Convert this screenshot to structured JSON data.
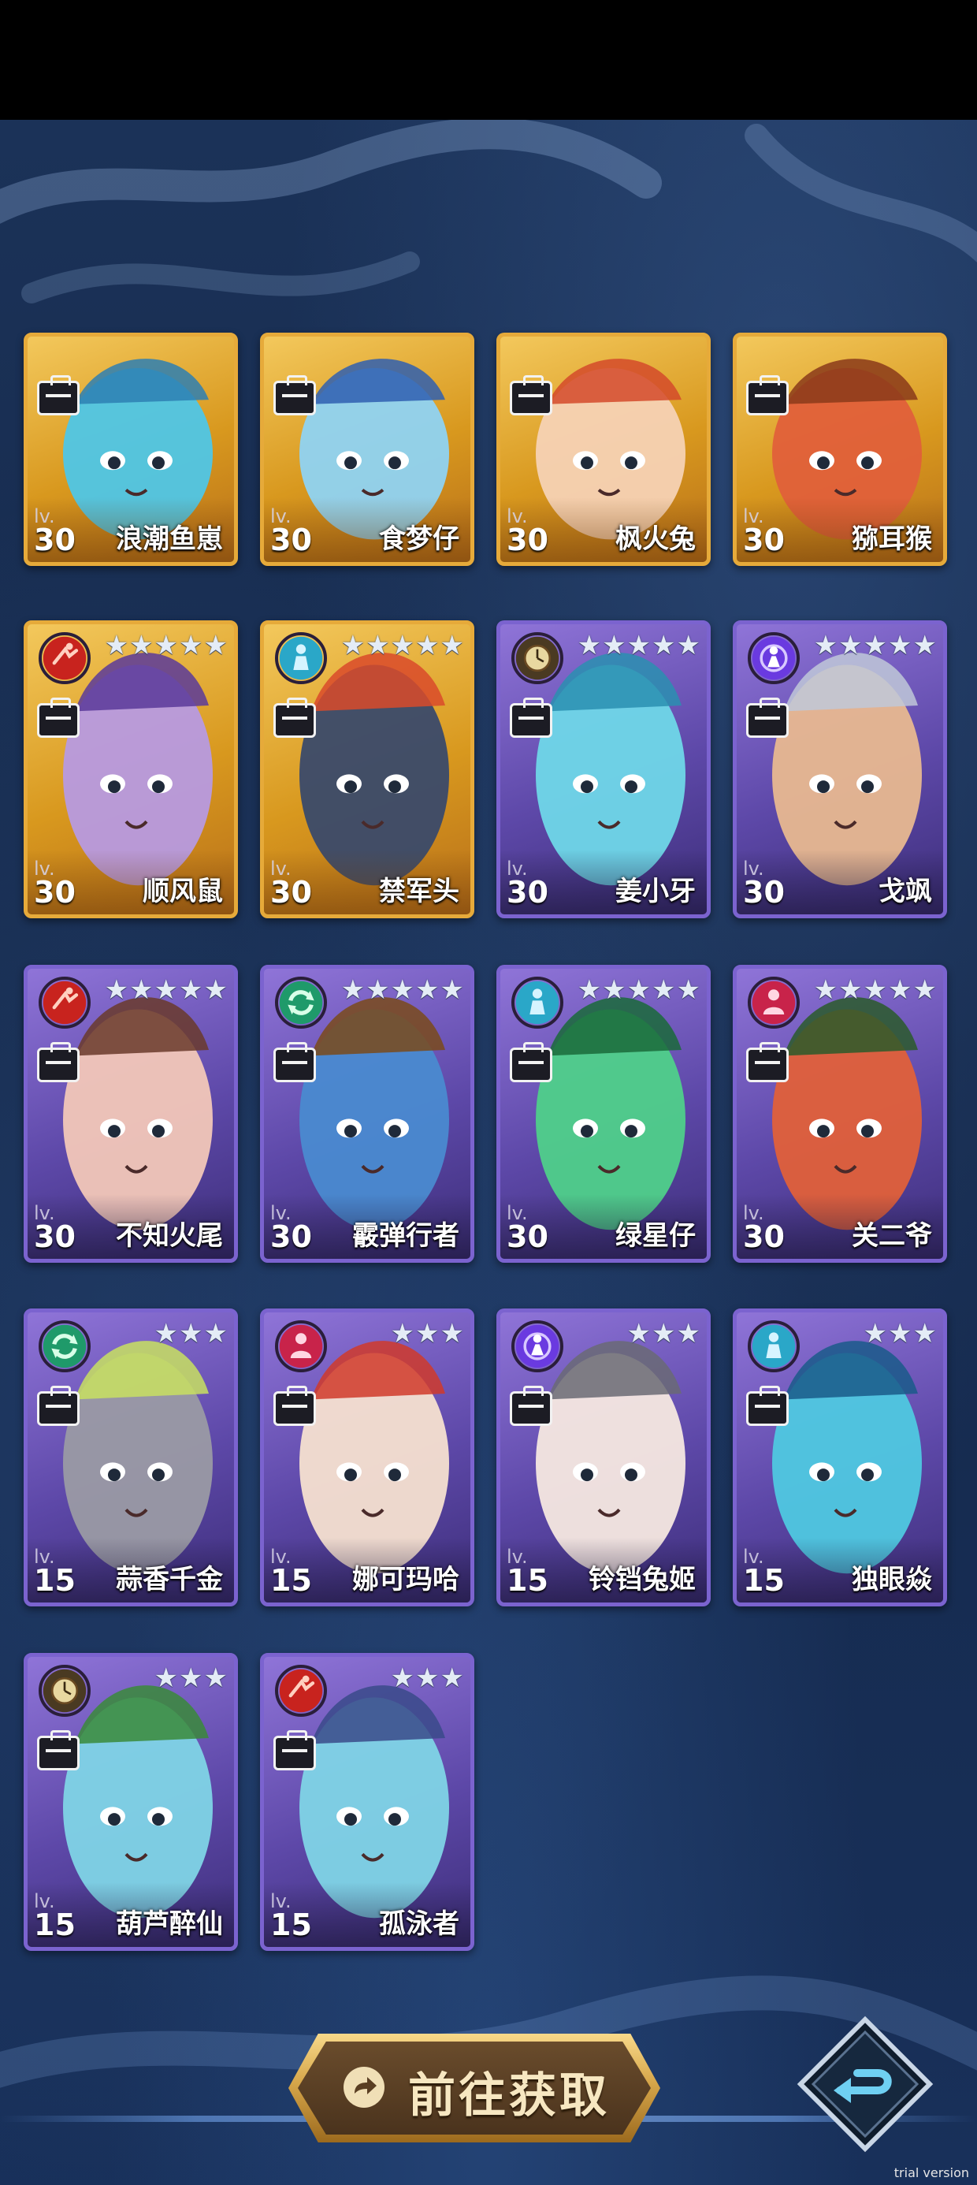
{
  "cards": [
    {
      "level": "30",
      "lv_tag": "lv.",
      "name": "浪潮鱼崽",
      "frame": "gold",
      "stars": 0,
      "badge": "",
      "clipped": true,
      "portrait": "#4fc6e6",
      "accent": "#2d7fb3"
    },
    {
      "level": "30",
      "lv_tag": "lv.",
      "name": "食梦仔",
      "frame": "gold",
      "stars": 0,
      "badge": "",
      "clipped": true,
      "portrait": "#8fd3f2",
      "accent": "#2f5fb0"
    },
    {
      "level": "30",
      "lv_tag": "lv.",
      "name": "枫火兔",
      "frame": "gold",
      "stars": 0,
      "badge": "",
      "clipped": true,
      "portrait": "#f6d2b4",
      "accent": "#d44a2a"
    },
    {
      "level": "30",
      "lv_tag": "lv.",
      "name": "猕耳猴",
      "frame": "gold",
      "stars": 0,
      "badge": "",
      "clipped": true,
      "portrait": "#e0603a",
      "accent": "#8a3a1a"
    },
    {
      "level": "30",
      "lv_tag": "lv.",
      "name": "顺风鼠",
      "frame": "gold",
      "stars": 5,
      "badge": "speed",
      "clipped": false,
      "portrait": "#b79ae0",
      "accent": "#5a3a9a"
    },
    {
      "level": "30",
      "lv_tag": "lv.",
      "name": "禁军头",
      "frame": "gold",
      "stars": 5,
      "badge": "defense",
      "clipped": false,
      "portrait": "#3a4a6a",
      "accent": "#d94a2a"
    },
    {
      "level": "30",
      "lv_tag": "lv.",
      "name": "姜小牙",
      "frame": "purple",
      "stars": 5,
      "badge": "time",
      "clipped": false,
      "portrait": "#6fd7e8",
      "accent": "#2a8fb0"
    },
    {
      "level": "30",
      "lv_tag": "lv.",
      "name": "戈飒",
      "frame": "purple",
      "stars": 5,
      "badge": "mystic",
      "clipped": false,
      "portrait": "#e8b890",
      "accent": "#c0c8d8"
    },
    {
      "level": "30",
      "lv_tag": "lv.",
      "name": "不知火尾",
      "frame": "purple",
      "stars": 5,
      "badge": "speed",
      "clipped": false,
      "portrait": "#f2c7b8",
      "accent": "#6a3a2a"
    },
    {
      "level": "30",
      "lv_tag": "lv.",
      "name": "霰弹行者",
      "frame": "purple",
      "stars": 5,
      "badge": "cycle",
      "clipped": false,
      "portrait": "#4a8ad0",
      "accent": "#7a4a1a"
    },
    {
      "level": "30",
      "lv_tag": "lv.",
      "name": "绿星仔",
      "frame": "purple",
      "stars": 5,
      "badge": "defense",
      "clipped": false,
      "portrait": "#4fd08a",
      "accent": "#1a6a3a"
    },
    {
      "level": "30",
      "lv_tag": "lv.",
      "name": "关二爷",
      "frame": "purple",
      "stars": 5,
      "badge": "team",
      "clipped": false,
      "portrait": "#e0603a",
      "accent": "#2a5a2a"
    },
    {
      "level": "15",
      "lv_tag": "lv.",
      "name": "蒜香千金",
      "frame": "purple",
      "stars": 3,
      "badge": "cycle",
      "clipped": false,
      "portrait": "#9a9aa4",
      "accent": "#c8e060"
    },
    {
      "level": "15",
      "lv_tag": "lv.",
      "name": "娜可玛哈",
      "frame": "purple",
      "stars": 3,
      "badge": "team",
      "clipped": false,
      "portrait": "#f6e0d0",
      "accent": "#d03a2a"
    },
    {
      "level": "15",
      "lv_tag": "lv.",
      "name": "铃铛兔姬",
      "frame": "purple",
      "stars": 3,
      "badge": "mystic",
      "clipped": false,
      "portrait": "#f6e8e0",
      "accent": "#6a6a74"
    },
    {
      "level": "15",
      "lv_tag": "lv.",
      "name": "独眼焱",
      "frame": "purple",
      "stars": 3,
      "badge": "defense",
      "clipped": false,
      "portrait": "#4fc8e0",
      "accent": "#1a5a8a"
    },
    {
      "level": "15",
      "lv_tag": "lv.",
      "name": "葫芦醉仙",
      "frame": "purple",
      "stars": 3,
      "badge": "time",
      "clipped": false,
      "portrait": "#7fd4e6",
      "accent": "#3a8a3a"
    },
    {
      "level": "15",
      "lv_tag": "lv.",
      "name": "孤泳者",
      "frame": "purple",
      "stars": 3,
      "badge": "speed",
      "clipped": false,
      "portrait": "#7fd4e6",
      "accent": "#3a4a8a"
    }
  ],
  "badge_colors": {
    "speed": "#c8231e",
    "defense": "#2aa7c8",
    "time": "#4a3a22",
    "mystic": "#6a3ae0",
    "cycle": "#1f9a6a",
    "team": "#c8234a"
  },
  "buttons": {
    "get_label": "前往获取",
    "get_icon": "redirect-arrow-icon",
    "back_icon": "return-arrow-icon"
  },
  "watermark": "trial version"
}
